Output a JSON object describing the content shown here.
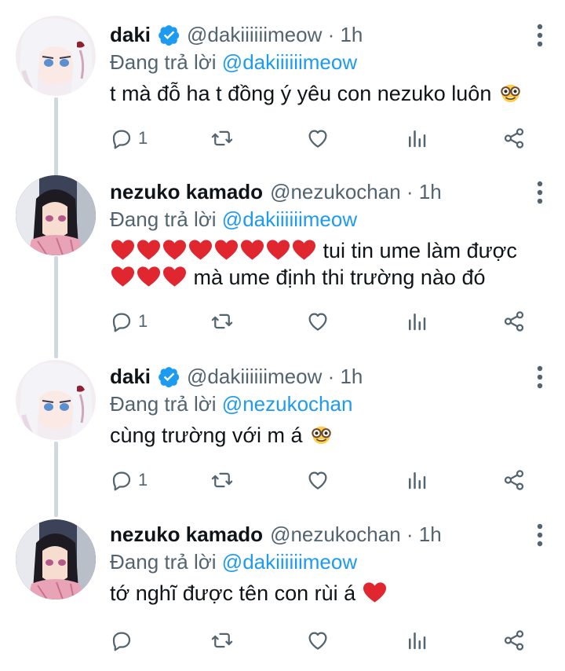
{
  "reply_prefix": "Đang trả lời",
  "tweets": [
    {
      "name": "daki",
      "verified": true,
      "handle_time": "@dakiiiiiimeow · 1h",
      "reply_to": "@dakiiiiiimeow",
      "text": "t mà đỗ ha t đồng ý yêu con nezuko luôn",
      "trailing_emoji": "nerd-face",
      "reply_count": "1"
    },
    {
      "name": "nezuko kamado",
      "verified": false,
      "handle_time": "@nezukochan · 1h",
      "reply_to": "@dakiiiiiimeow",
      "line1_text": "tui tin ume làm được",
      "line2_text": "mà ume định thi trường nào đó",
      "hearts_line1": 8,
      "hearts_line2": 3,
      "reply_count": "1"
    },
    {
      "name": "daki",
      "verified": true,
      "handle_time": "@dakiiiiiimeow · 1h",
      "reply_to": "@nezukochan",
      "text": "cùng trường với m á",
      "trailing_emoji": "nerd-face",
      "reply_count": "1"
    },
    {
      "name": "nezuko kamado",
      "verified": false,
      "handle_time": "@nezukochan · 1h",
      "reply_to": "@dakiiiiiimeow",
      "text": "tớ nghĩ được tên con rùi á",
      "trailing_emoji": "red-heart",
      "reply_count": ""
    }
  ],
  "colors": {
    "accent": "#1d9bf0",
    "muted": "#536471",
    "thread_line": "#cfd9de",
    "heart": "#e0262f"
  }
}
